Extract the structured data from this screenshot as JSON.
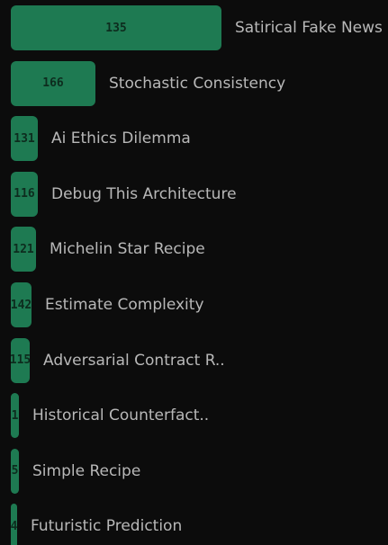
{
  "colors": {
    "background": "#0c0c0c",
    "bar": "#1e7a52",
    "bar_value_text": "#0d2c1e",
    "label_text": "#b8b8b8"
  },
  "chart_data": {
    "type": "bar",
    "orientation": "horizontal",
    "title": "",
    "xlabel": "",
    "ylabel": "",
    "grid": false,
    "legend": "none",
    "categories": [
      "Satirical Fake News",
      "Stochastic Consistency",
      "Ai Ethics Dilemma",
      "Debug This Architecture",
      "Michelin Star Recipe",
      "Estimate Complexity",
      "Adversarial Contract R..",
      "Historical Counterfact..",
      "Simple Recipe",
      "Futuristic Prediction"
    ],
    "values": [
      135,
      166,
      131,
      116,
      121,
      142,
      115,
      1,
      5,
      4
    ],
    "bar_lengths_relative": [
      1.0,
      0.4,
      0.13,
      0.13,
      0.12,
      0.1,
      0.09,
      0.04,
      0.04,
      0.03
    ]
  }
}
